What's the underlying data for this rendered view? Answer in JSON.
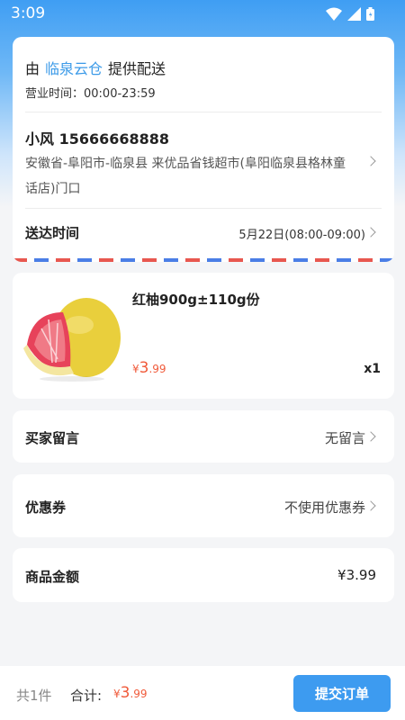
{
  "status_bar": {
    "time": "3:09"
  },
  "address_card": {
    "delivery_prefix": "由",
    "store_name": "临泉云仓",
    "delivery_suffix": "提供配送",
    "hours": "营业时间：00:00-23:59",
    "contact": "小风 15666668888",
    "address": "安徽省-阜阳市-临泉县 来优品省钱超市(阜阳临泉县格林童话店)门口",
    "time_label": "送达时间",
    "time_value": "5月22日(08:00-09:00)"
  },
  "product": {
    "title": "红柚900g±110g份",
    "price_symbol": "¥",
    "price_int": "3",
    "price_dec": ".99",
    "quantity": "x1"
  },
  "message": {
    "label": "买家留言",
    "value": "无留言"
  },
  "coupon": {
    "label": "优惠券",
    "value": "不使用优惠券"
  },
  "amount": {
    "label": "商品金额",
    "value": "¥3.99"
  },
  "bottom_bar": {
    "count": "共1件",
    "total_label": "合计:",
    "total_symbol": "¥",
    "total_int": "3",
    "total_dec": ".99",
    "submit_label": "提交订单"
  },
  "colors": {
    "accent": "#3d9bf0",
    "price": "#f05a3a",
    "store_link": "#3b9ae8"
  }
}
